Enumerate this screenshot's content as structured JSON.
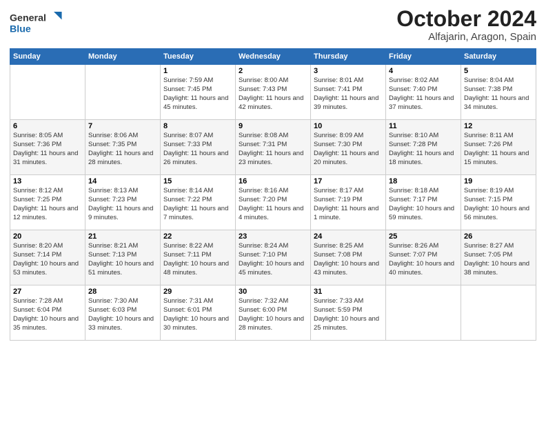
{
  "header": {
    "logo_general": "General",
    "logo_blue": "Blue",
    "title": "October 2024",
    "location": "Alfajarin, Aragon, Spain"
  },
  "days_of_week": [
    "Sunday",
    "Monday",
    "Tuesday",
    "Wednesday",
    "Thursday",
    "Friday",
    "Saturday"
  ],
  "weeks": [
    [
      {
        "day": "",
        "sunrise": "",
        "sunset": "",
        "daylight": ""
      },
      {
        "day": "",
        "sunrise": "",
        "sunset": "",
        "daylight": ""
      },
      {
        "day": "1",
        "sunrise": "Sunrise: 7:59 AM",
        "sunset": "Sunset: 7:45 PM",
        "daylight": "Daylight: 11 hours and 45 minutes."
      },
      {
        "day": "2",
        "sunrise": "Sunrise: 8:00 AM",
        "sunset": "Sunset: 7:43 PM",
        "daylight": "Daylight: 11 hours and 42 minutes."
      },
      {
        "day": "3",
        "sunrise": "Sunrise: 8:01 AM",
        "sunset": "Sunset: 7:41 PM",
        "daylight": "Daylight: 11 hours and 39 minutes."
      },
      {
        "day": "4",
        "sunrise": "Sunrise: 8:02 AM",
        "sunset": "Sunset: 7:40 PM",
        "daylight": "Daylight: 11 hours and 37 minutes."
      },
      {
        "day": "5",
        "sunrise": "Sunrise: 8:04 AM",
        "sunset": "Sunset: 7:38 PM",
        "daylight": "Daylight: 11 hours and 34 minutes."
      }
    ],
    [
      {
        "day": "6",
        "sunrise": "Sunrise: 8:05 AM",
        "sunset": "Sunset: 7:36 PM",
        "daylight": "Daylight: 11 hours and 31 minutes."
      },
      {
        "day": "7",
        "sunrise": "Sunrise: 8:06 AM",
        "sunset": "Sunset: 7:35 PM",
        "daylight": "Daylight: 11 hours and 28 minutes."
      },
      {
        "day": "8",
        "sunrise": "Sunrise: 8:07 AM",
        "sunset": "Sunset: 7:33 PM",
        "daylight": "Daylight: 11 hours and 26 minutes."
      },
      {
        "day": "9",
        "sunrise": "Sunrise: 8:08 AM",
        "sunset": "Sunset: 7:31 PM",
        "daylight": "Daylight: 11 hours and 23 minutes."
      },
      {
        "day": "10",
        "sunrise": "Sunrise: 8:09 AM",
        "sunset": "Sunset: 7:30 PM",
        "daylight": "Daylight: 11 hours and 20 minutes."
      },
      {
        "day": "11",
        "sunrise": "Sunrise: 8:10 AM",
        "sunset": "Sunset: 7:28 PM",
        "daylight": "Daylight: 11 hours and 18 minutes."
      },
      {
        "day": "12",
        "sunrise": "Sunrise: 8:11 AM",
        "sunset": "Sunset: 7:26 PM",
        "daylight": "Daylight: 11 hours and 15 minutes."
      }
    ],
    [
      {
        "day": "13",
        "sunrise": "Sunrise: 8:12 AM",
        "sunset": "Sunset: 7:25 PM",
        "daylight": "Daylight: 11 hours and 12 minutes."
      },
      {
        "day": "14",
        "sunrise": "Sunrise: 8:13 AM",
        "sunset": "Sunset: 7:23 PM",
        "daylight": "Daylight: 11 hours and 9 minutes."
      },
      {
        "day": "15",
        "sunrise": "Sunrise: 8:14 AM",
        "sunset": "Sunset: 7:22 PM",
        "daylight": "Daylight: 11 hours and 7 minutes."
      },
      {
        "day": "16",
        "sunrise": "Sunrise: 8:16 AM",
        "sunset": "Sunset: 7:20 PM",
        "daylight": "Daylight: 11 hours and 4 minutes."
      },
      {
        "day": "17",
        "sunrise": "Sunrise: 8:17 AM",
        "sunset": "Sunset: 7:19 PM",
        "daylight": "Daylight: 11 hours and 1 minute."
      },
      {
        "day": "18",
        "sunrise": "Sunrise: 8:18 AM",
        "sunset": "Sunset: 7:17 PM",
        "daylight": "Daylight: 10 hours and 59 minutes."
      },
      {
        "day": "19",
        "sunrise": "Sunrise: 8:19 AM",
        "sunset": "Sunset: 7:15 PM",
        "daylight": "Daylight: 10 hours and 56 minutes."
      }
    ],
    [
      {
        "day": "20",
        "sunrise": "Sunrise: 8:20 AM",
        "sunset": "Sunset: 7:14 PM",
        "daylight": "Daylight: 10 hours and 53 minutes."
      },
      {
        "day": "21",
        "sunrise": "Sunrise: 8:21 AM",
        "sunset": "Sunset: 7:13 PM",
        "daylight": "Daylight: 10 hours and 51 minutes."
      },
      {
        "day": "22",
        "sunrise": "Sunrise: 8:22 AM",
        "sunset": "Sunset: 7:11 PM",
        "daylight": "Daylight: 10 hours and 48 minutes."
      },
      {
        "day": "23",
        "sunrise": "Sunrise: 8:24 AM",
        "sunset": "Sunset: 7:10 PM",
        "daylight": "Daylight: 10 hours and 45 minutes."
      },
      {
        "day": "24",
        "sunrise": "Sunrise: 8:25 AM",
        "sunset": "Sunset: 7:08 PM",
        "daylight": "Daylight: 10 hours and 43 minutes."
      },
      {
        "day": "25",
        "sunrise": "Sunrise: 8:26 AM",
        "sunset": "Sunset: 7:07 PM",
        "daylight": "Daylight: 10 hours and 40 minutes."
      },
      {
        "day": "26",
        "sunrise": "Sunrise: 8:27 AM",
        "sunset": "Sunset: 7:05 PM",
        "daylight": "Daylight: 10 hours and 38 minutes."
      }
    ],
    [
      {
        "day": "27",
        "sunrise": "Sunrise: 7:28 AM",
        "sunset": "Sunset: 6:04 PM",
        "daylight": "Daylight: 10 hours and 35 minutes."
      },
      {
        "day": "28",
        "sunrise": "Sunrise: 7:30 AM",
        "sunset": "Sunset: 6:03 PM",
        "daylight": "Daylight: 10 hours and 33 minutes."
      },
      {
        "day": "29",
        "sunrise": "Sunrise: 7:31 AM",
        "sunset": "Sunset: 6:01 PM",
        "daylight": "Daylight: 10 hours and 30 minutes."
      },
      {
        "day": "30",
        "sunrise": "Sunrise: 7:32 AM",
        "sunset": "Sunset: 6:00 PM",
        "daylight": "Daylight: 10 hours and 28 minutes."
      },
      {
        "day": "31",
        "sunrise": "Sunrise: 7:33 AM",
        "sunset": "Sunset: 5:59 PM",
        "daylight": "Daylight: 10 hours and 25 minutes."
      },
      {
        "day": "",
        "sunrise": "",
        "sunset": "",
        "daylight": ""
      },
      {
        "day": "",
        "sunrise": "",
        "sunset": "",
        "daylight": ""
      }
    ]
  ]
}
